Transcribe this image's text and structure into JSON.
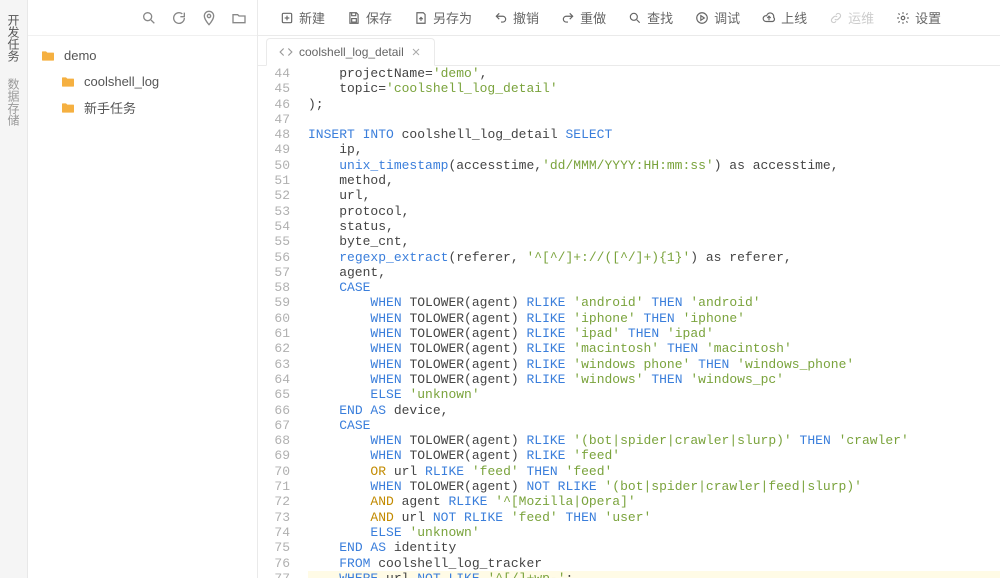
{
  "rail": {
    "items": [
      "开发任务",
      "数据存储"
    ],
    "active": 0
  },
  "filePanel": {
    "toolIcons": [
      "search-icon",
      "refresh-icon",
      "location-icon",
      "newfolder-icon"
    ],
    "tree": [
      {
        "label": "demo",
        "depth": 0
      },
      {
        "label": "coolshell_log",
        "depth": 1
      },
      {
        "label": "新手任务",
        "depth": 1
      }
    ]
  },
  "toolbar": [
    {
      "name": "new-button",
      "label": "新建",
      "icon": "plus-icon"
    },
    {
      "name": "save-button",
      "label": "保存",
      "icon": "save-icon"
    },
    {
      "name": "saveas-button",
      "label": "另存为",
      "icon": "saveas-icon"
    },
    {
      "name": "undo-button",
      "label": "撤销",
      "icon": "undo-icon"
    },
    {
      "name": "redo-button",
      "label": "重做",
      "icon": "redo-icon"
    },
    {
      "name": "find-button",
      "label": "查找",
      "icon": "search-icon"
    },
    {
      "name": "debug-button",
      "label": "调试",
      "icon": "play-icon"
    },
    {
      "name": "publish-button",
      "label": "上线",
      "icon": "cloud-up-icon"
    },
    {
      "name": "ops-button",
      "label": "运维",
      "icon": "link-icon",
      "disabled": true
    },
    {
      "name": "settings-button",
      "label": "设置",
      "icon": "gear-icon"
    }
  ],
  "tabs": [
    {
      "label": "coolshell_log_detail"
    }
  ],
  "code": {
    "startLine": 44,
    "lines": [
      [
        {
          "t": "    projectName=",
          "c": "tk-txt"
        },
        {
          "t": "'demo'",
          "c": "tk-str"
        },
        {
          "t": ",",
          "c": "tk-txt"
        }
      ],
      [
        {
          "t": "    topic=",
          "c": "tk-txt"
        },
        {
          "t": "'coolshell_log_detail'",
          "c": "tk-str"
        }
      ],
      [
        {
          "t": ");",
          "c": "tk-txt"
        }
      ],
      [
        {
          "t": "",
          "c": "tk-txt"
        }
      ],
      [
        {
          "t": "INSERT INTO",
          "c": "tk-kw"
        },
        {
          "t": " coolshell_log_detail ",
          "c": "tk-txt"
        },
        {
          "t": "SELECT",
          "c": "tk-kw"
        }
      ],
      [
        {
          "t": "    ip,",
          "c": "tk-txt"
        }
      ],
      [
        {
          "t": "    ",
          "c": "tk-txt"
        },
        {
          "t": "unix_timestamp",
          "c": "tk-fn"
        },
        {
          "t": "(accesstime,",
          "c": "tk-txt"
        },
        {
          "t": "'dd/MMM/YYYY:HH:mm:ss'",
          "c": "tk-str"
        },
        {
          "t": ") as accesstime,",
          "c": "tk-txt"
        }
      ],
      [
        {
          "t": "    method,",
          "c": "tk-txt"
        }
      ],
      [
        {
          "t": "    url,",
          "c": "tk-txt"
        }
      ],
      [
        {
          "t": "    protocol,",
          "c": "tk-txt"
        }
      ],
      [
        {
          "t": "    status,",
          "c": "tk-txt"
        }
      ],
      [
        {
          "t": "    byte_cnt,",
          "c": "tk-txt"
        }
      ],
      [
        {
          "t": "    ",
          "c": "tk-txt"
        },
        {
          "t": "regexp_extract",
          "c": "tk-fn"
        },
        {
          "t": "(referer, ",
          "c": "tk-txt"
        },
        {
          "t": "'^[^/]+://([^/]+){1}'",
          "c": "tk-str"
        },
        {
          "t": ") as referer,",
          "c": "tk-txt"
        }
      ],
      [
        {
          "t": "    agent,",
          "c": "tk-txt"
        }
      ],
      [
        {
          "t": "    ",
          "c": "tk-txt"
        },
        {
          "t": "CASE",
          "c": "tk-kw"
        }
      ],
      [
        {
          "t": "        ",
          "c": "tk-txt"
        },
        {
          "t": "WHEN",
          "c": "tk-kw"
        },
        {
          "t": " TOLOWER(agent) ",
          "c": "tk-txt"
        },
        {
          "t": "RLIKE",
          "c": "tk-kw"
        },
        {
          "t": " ",
          "c": "tk-txt"
        },
        {
          "t": "'android'",
          "c": "tk-str"
        },
        {
          "t": " ",
          "c": "tk-txt"
        },
        {
          "t": "THEN",
          "c": "tk-kw"
        },
        {
          "t": " ",
          "c": "tk-txt"
        },
        {
          "t": "'android'",
          "c": "tk-str"
        }
      ],
      [
        {
          "t": "        ",
          "c": "tk-txt"
        },
        {
          "t": "WHEN",
          "c": "tk-kw"
        },
        {
          "t": " TOLOWER(agent) ",
          "c": "tk-txt"
        },
        {
          "t": "RLIKE",
          "c": "tk-kw"
        },
        {
          "t": " ",
          "c": "tk-txt"
        },
        {
          "t": "'iphone'",
          "c": "tk-str"
        },
        {
          "t": " ",
          "c": "tk-txt"
        },
        {
          "t": "THEN",
          "c": "tk-kw"
        },
        {
          "t": " ",
          "c": "tk-txt"
        },
        {
          "t": "'iphone'",
          "c": "tk-str"
        }
      ],
      [
        {
          "t": "        ",
          "c": "tk-txt"
        },
        {
          "t": "WHEN",
          "c": "tk-kw"
        },
        {
          "t": " TOLOWER(agent) ",
          "c": "tk-txt"
        },
        {
          "t": "RLIKE",
          "c": "tk-kw"
        },
        {
          "t": " ",
          "c": "tk-txt"
        },
        {
          "t": "'ipad'",
          "c": "tk-str"
        },
        {
          "t": " ",
          "c": "tk-txt"
        },
        {
          "t": "THEN",
          "c": "tk-kw"
        },
        {
          "t": " ",
          "c": "tk-txt"
        },
        {
          "t": "'ipad'",
          "c": "tk-str"
        }
      ],
      [
        {
          "t": "        ",
          "c": "tk-txt"
        },
        {
          "t": "WHEN",
          "c": "tk-kw"
        },
        {
          "t": " TOLOWER(agent) ",
          "c": "tk-txt"
        },
        {
          "t": "RLIKE",
          "c": "tk-kw"
        },
        {
          "t": " ",
          "c": "tk-txt"
        },
        {
          "t": "'macintosh'",
          "c": "tk-str"
        },
        {
          "t": " ",
          "c": "tk-txt"
        },
        {
          "t": "THEN",
          "c": "tk-kw"
        },
        {
          "t": " ",
          "c": "tk-txt"
        },
        {
          "t": "'macintosh'",
          "c": "tk-str"
        }
      ],
      [
        {
          "t": "        ",
          "c": "tk-txt"
        },
        {
          "t": "WHEN",
          "c": "tk-kw"
        },
        {
          "t": " TOLOWER(agent) ",
          "c": "tk-txt"
        },
        {
          "t": "RLIKE",
          "c": "tk-kw"
        },
        {
          "t": " ",
          "c": "tk-txt"
        },
        {
          "t": "'windows phone'",
          "c": "tk-str"
        },
        {
          "t": " ",
          "c": "tk-txt"
        },
        {
          "t": "THEN",
          "c": "tk-kw"
        },
        {
          "t": " ",
          "c": "tk-txt"
        },
        {
          "t": "'windows_phone'",
          "c": "tk-str"
        }
      ],
      [
        {
          "t": "        ",
          "c": "tk-txt"
        },
        {
          "t": "WHEN",
          "c": "tk-kw"
        },
        {
          "t": " TOLOWER(agent) ",
          "c": "tk-txt"
        },
        {
          "t": "RLIKE",
          "c": "tk-kw"
        },
        {
          "t": " ",
          "c": "tk-txt"
        },
        {
          "t": "'windows'",
          "c": "tk-str"
        },
        {
          "t": " ",
          "c": "tk-txt"
        },
        {
          "t": "THEN",
          "c": "tk-kw"
        },
        {
          "t": " ",
          "c": "tk-txt"
        },
        {
          "t": "'windows_pc'",
          "c": "tk-str"
        }
      ],
      [
        {
          "t": "        ",
          "c": "tk-txt"
        },
        {
          "t": "ELSE",
          "c": "tk-kw"
        },
        {
          "t": " ",
          "c": "tk-txt"
        },
        {
          "t": "'unknown'",
          "c": "tk-str"
        }
      ],
      [
        {
          "t": "    ",
          "c": "tk-txt"
        },
        {
          "t": "END AS",
          "c": "tk-kw"
        },
        {
          "t": " device,",
          "c": "tk-txt"
        }
      ],
      [
        {
          "t": "    ",
          "c": "tk-txt"
        },
        {
          "t": "CASE",
          "c": "tk-kw"
        }
      ],
      [
        {
          "t": "        ",
          "c": "tk-txt"
        },
        {
          "t": "WHEN",
          "c": "tk-kw"
        },
        {
          "t": " TOLOWER(agent) ",
          "c": "tk-txt"
        },
        {
          "t": "RLIKE",
          "c": "tk-kw"
        },
        {
          "t": " ",
          "c": "tk-txt"
        },
        {
          "t": "'(bot|spider|crawler|slurp)'",
          "c": "tk-str"
        },
        {
          "t": " ",
          "c": "tk-txt"
        },
        {
          "t": "THEN",
          "c": "tk-kw"
        },
        {
          "t": " ",
          "c": "tk-txt"
        },
        {
          "t": "'crawler'",
          "c": "tk-str"
        }
      ],
      [
        {
          "t": "        ",
          "c": "tk-txt"
        },
        {
          "t": "WHEN",
          "c": "tk-kw"
        },
        {
          "t": " TOLOWER(agent) ",
          "c": "tk-txt"
        },
        {
          "t": "RLIKE",
          "c": "tk-kw"
        },
        {
          "t": " ",
          "c": "tk-txt"
        },
        {
          "t": "'feed'",
          "c": "tk-str"
        }
      ],
      [
        {
          "t": "        ",
          "c": "tk-txt"
        },
        {
          "t": "OR",
          "c": "tk-or"
        },
        {
          "t": " url ",
          "c": "tk-txt"
        },
        {
          "t": "RLIKE",
          "c": "tk-kw"
        },
        {
          "t": " ",
          "c": "tk-txt"
        },
        {
          "t": "'feed'",
          "c": "tk-str"
        },
        {
          "t": " ",
          "c": "tk-txt"
        },
        {
          "t": "THEN",
          "c": "tk-kw"
        },
        {
          "t": " ",
          "c": "tk-txt"
        },
        {
          "t": "'feed'",
          "c": "tk-str"
        }
      ],
      [
        {
          "t": "        ",
          "c": "tk-txt"
        },
        {
          "t": "WHEN",
          "c": "tk-kw"
        },
        {
          "t": " TOLOWER(agent) ",
          "c": "tk-txt"
        },
        {
          "t": "NOT RLIKE",
          "c": "tk-kw"
        },
        {
          "t": " ",
          "c": "tk-txt"
        },
        {
          "t": "'(bot|spider|crawler|feed|slurp)'",
          "c": "tk-str"
        }
      ],
      [
        {
          "t": "        ",
          "c": "tk-txt"
        },
        {
          "t": "AND",
          "c": "tk-or"
        },
        {
          "t": " agent ",
          "c": "tk-txt"
        },
        {
          "t": "RLIKE",
          "c": "tk-kw"
        },
        {
          "t": " ",
          "c": "tk-txt"
        },
        {
          "t": "'^[Mozilla|Opera]'",
          "c": "tk-str"
        }
      ],
      [
        {
          "t": "        ",
          "c": "tk-txt"
        },
        {
          "t": "AND",
          "c": "tk-or"
        },
        {
          "t": " url ",
          "c": "tk-txt"
        },
        {
          "t": "NOT RLIKE",
          "c": "tk-kw"
        },
        {
          "t": " ",
          "c": "tk-txt"
        },
        {
          "t": "'feed'",
          "c": "tk-str"
        },
        {
          "t": " ",
          "c": "tk-txt"
        },
        {
          "t": "THEN",
          "c": "tk-kw"
        },
        {
          "t": " ",
          "c": "tk-txt"
        },
        {
          "t": "'user'",
          "c": "tk-str"
        }
      ],
      [
        {
          "t": "        ",
          "c": "tk-txt"
        },
        {
          "t": "ELSE",
          "c": "tk-kw"
        },
        {
          "t": " ",
          "c": "tk-txt"
        },
        {
          "t": "'unknown'",
          "c": "tk-str"
        }
      ],
      [
        {
          "t": "    ",
          "c": "tk-txt"
        },
        {
          "t": "END AS",
          "c": "tk-kw"
        },
        {
          "t": " identity",
          "c": "tk-txt"
        }
      ],
      [
        {
          "t": "    ",
          "c": "tk-txt"
        },
        {
          "t": "FROM",
          "c": "tk-kw"
        },
        {
          "t": " coolshell_log_tracker",
          "c": "tk-txt"
        }
      ],
      [
        {
          "t": "    ",
          "c": "tk-txt"
        },
        {
          "t": "WHERE",
          "c": "tk-kw"
        },
        {
          "t": " url ",
          "c": "tk-txt"
        },
        {
          "t": "NOT LIKE",
          "c": "tk-kw"
        },
        {
          "t": " ",
          "c": "tk-txt"
        },
        {
          "t": "'^[/]+wp-'",
          "c": "tk-str"
        },
        {
          "t": ";",
          "c": "tk-txt"
        }
      ]
    ],
    "highlight": 77
  }
}
